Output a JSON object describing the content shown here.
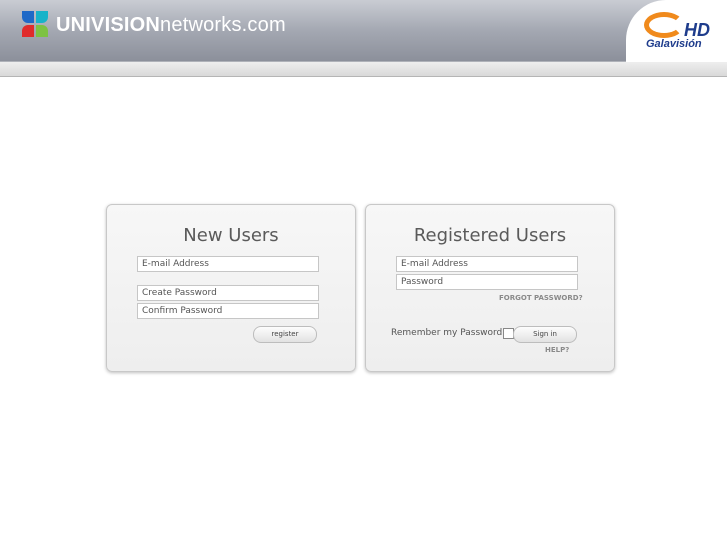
{
  "header": {
    "brand_bold": "UNIVISION",
    "brand_light": "networks.com",
    "partner_hd": "HD",
    "partner_name": "Galavisión"
  },
  "new_users": {
    "title": "New Users",
    "email_placeholder": "E-mail Address",
    "create_password_placeholder": "Create Password",
    "confirm_password_placeholder": "Confirm Password",
    "register_label": "register"
  },
  "registered_users": {
    "title": "Registered Users",
    "email_placeholder": "E-mail Address",
    "password_placeholder": "Password",
    "forgot_label": "FORGOT PASSWORD?",
    "remember_label": "Remember my Password",
    "sign_in_label": "Sign in",
    "help_label": "HELP?"
  }
}
